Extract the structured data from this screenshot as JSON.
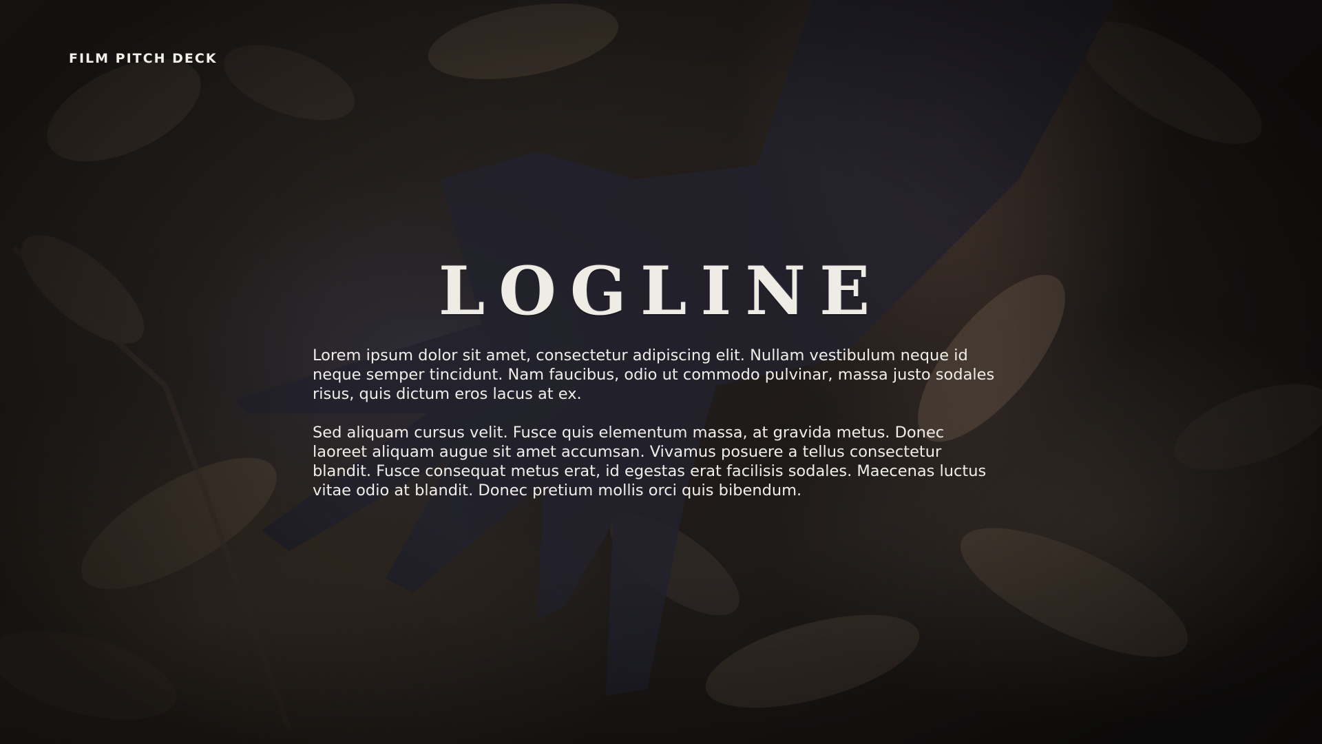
{
  "slide": {
    "deck_label": "FILM PITCH DECK",
    "title": "LOGLINE",
    "paragraphs": [
      "Lorem ipsum dolor sit amet, consectetur adipiscing elit. Nullam vestibulum neque id neque semper tincidunt. Nam faucibus, odio ut commodo pulvinar, massa justo sodales risus, quis dictum eros lacus at ex.",
      "Sed aliquam cursus velit. Fusce quis elementum massa, at gravida metus. Donec laoreet aliquam augue sit amet accumsan. Vivamus posuere a tellus consectetur blandit. Fusce consequat metus erat, id egestas erat facilisis sodales. Maecenas luctus vitae odio at blandit. Donec pretium mollis orci quis bibendum."
    ]
  },
  "colors": {
    "text": "#f1eee9",
    "background": "#2b2520"
  }
}
